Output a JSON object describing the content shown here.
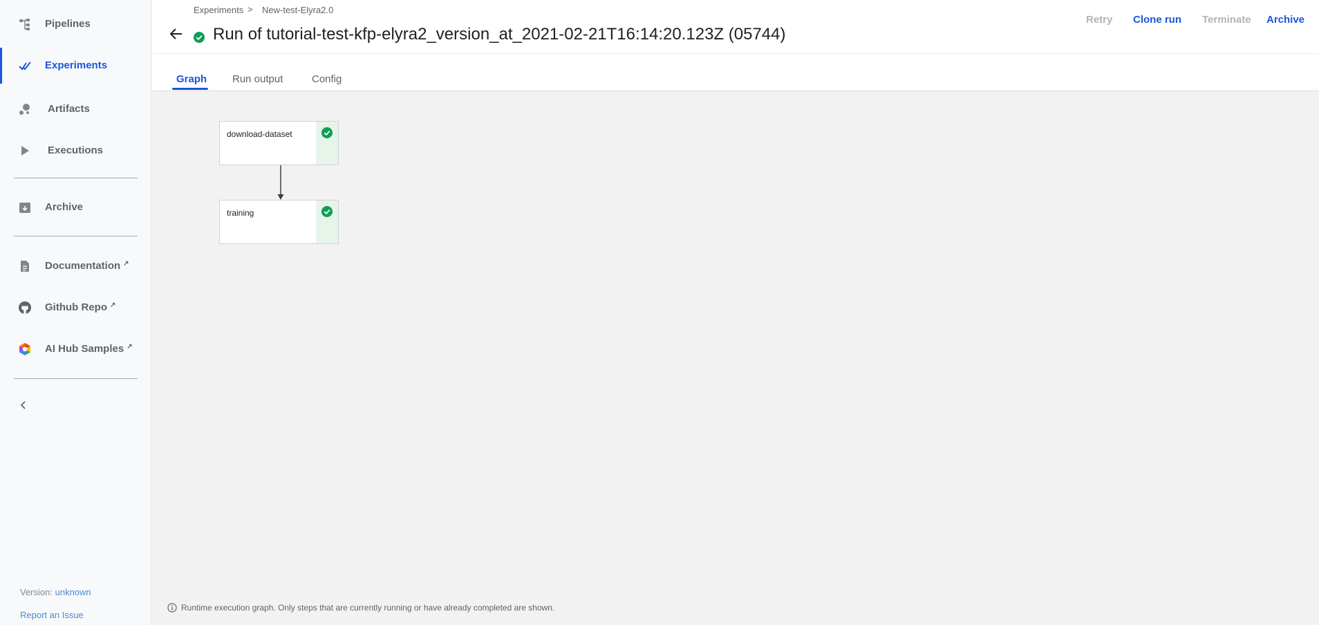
{
  "sidebar": {
    "items": [
      {
        "label": "Pipelines",
        "icon": "pipelines-icon",
        "active": false
      },
      {
        "label": "Experiments",
        "icon": "experiments-icon",
        "active": true
      },
      {
        "label": "Artifacts",
        "icon": "artifacts-icon",
        "active": false
      },
      {
        "label": "Executions",
        "icon": "executions-icon",
        "active": false
      },
      {
        "label": "Archive",
        "icon": "archive-icon",
        "active": false
      },
      {
        "label": "Documentation",
        "icon": "documentation-icon",
        "external": true
      },
      {
        "label": "Github Repo",
        "icon": "github-icon",
        "external": true
      },
      {
        "label": "AI Hub Samples",
        "icon": "ai-hub-icon",
        "external": true
      }
    ],
    "version_label": "Version:",
    "version_value": "unknown",
    "report_issue": "Report an Issue"
  },
  "header": {
    "breadcrumbs": [
      "Experiments",
      "New-test-Elyra2.0"
    ],
    "breadcrumb_separator": ">",
    "title": "Run of tutorial-test-kfp-elyra2_version_at_2021-02-21T16:14:20.123Z (05744)",
    "actions": {
      "retry": "Retry",
      "clone_run": "Clone run",
      "terminate": "Terminate",
      "archive": "Archive"
    }
  },
  "tabs": [
    "Graph",
    "Run output",
    "Config"
  ],
  "graph": {
    "nodes": [
      {
        "label": "download-dataset",
        "status": "succeeded"
      },
      {
        "label": "training",
        "status": "succeeded"
      }
    ],
    "footnote": "Runtime execution graph. Only steps that are currently running or have already completed are shown."
  },
  "colors": {
    "accent": "#1a56db",
    "success": "#0f9d58",
    "success_bg": "#e6f4ea",
    "canvas_bg": "#f2f2f2"
  }
}
